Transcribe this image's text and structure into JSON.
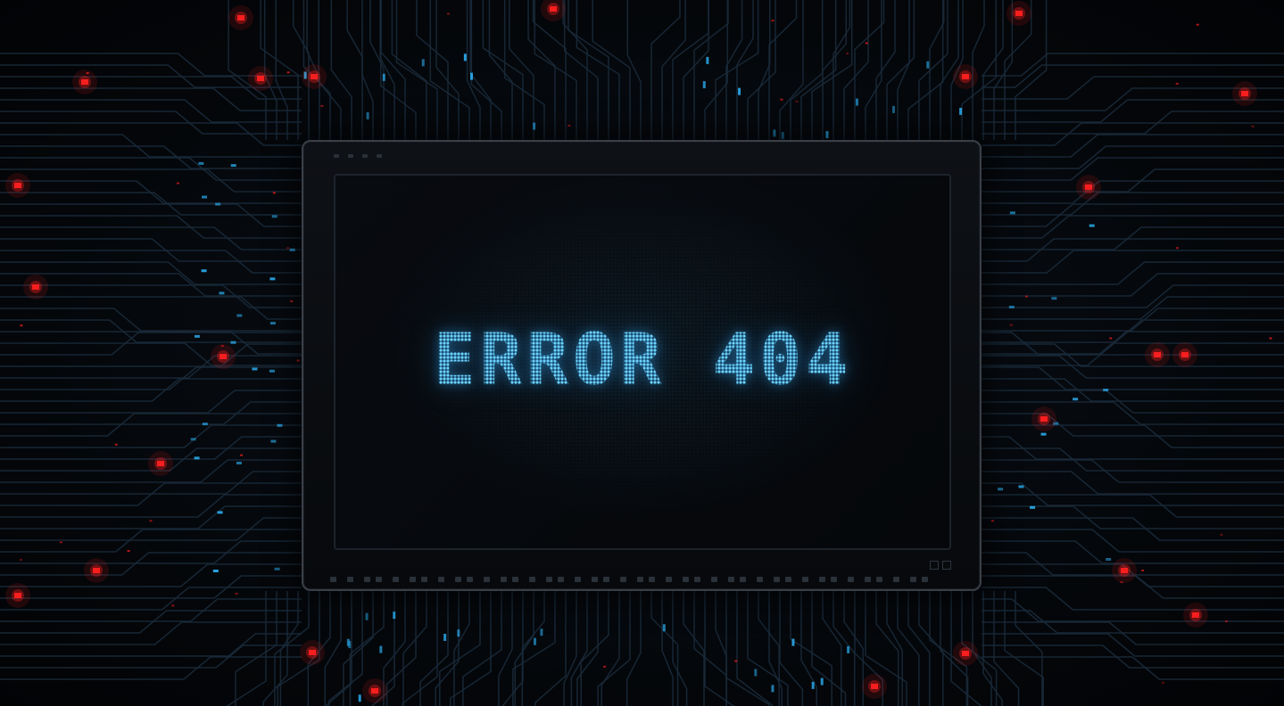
{
  "screen": {
    "error_message": "ERROR 404"
  },
  "colors": {
    "glow_primary": "#6fd4ff",
    "glow_secondary": "#1e82dc",
    "trace_color": "#1a2a3a",
    "accent_red": "#ff2020",
    "accent_cyan": "#2aa8e8",
    "frame_border": "#3a3f47"
  },
  "icons": {
    "background": "circuit-board-icon"
  }
}
